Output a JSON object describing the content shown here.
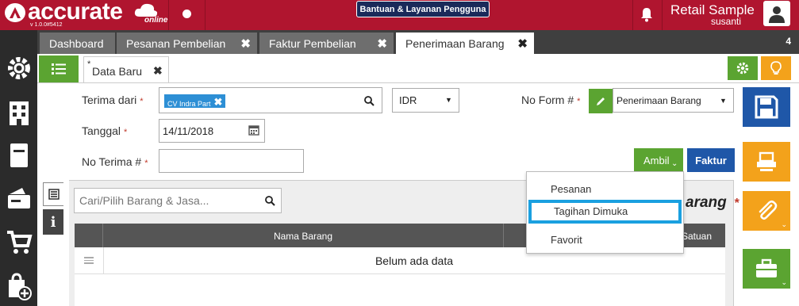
{
  "app": {
    "logo_text": "accurate",
    "logo_online": "online",
    "version": "v 1.0.0#5412",
    "help_label": "Bantuan & Layanan Pengguna",
    "company": "Retail Sample",
    "user": "susanti"
  },
  "tabs": [
    {
      "label": "Dashboard"
    },
    {
      "label": "Pesanan Pembelian"
    },
    {
      "label": "Faktur Pembelian"
    },
    {
      "label": "Penerimaan Barang"
    }
  ],
  "tab_count": "4",
  "subtab": {
    "star": "*",
    "label": "Data Baru"
  },
  "form": {
    "terima_dari_label": "Terima dari",
    "vendor_tag": "CV Indra Part",
    "currency": "IDR",
    "no_form_label": "No Form #",
    "form_type": "Penerimaan Barang",
    "tanggal_label": "Tanggal",
    "tanggal_value": "14/11/2018",
    "no_terima_label": "No Terima #",
    "no_terima_value": "",
    "required_mark": "*"
  },
  "buttons": {
    "ambil": "Ambil",
    "faktur": "Faktur"
  },
  "detail": {
    "search_placeholder": "Cari/Pilih Barang & Jasa...",
    "barang_title": "arang",
    "col_nama": "Nama Barang",
    "col_satuan": "Satuan",
    "empty_text": "Belum ada data"
  },
  "menu": {
    "items": [
      {
        "label": "Pesanan"
      },
      {
        "label": "Tagihan Dimuka"
      },
      {
        "label": "Favorit"
      }
    ]
  },
  "colors": {
    "brand_red": "#b0152f",
    "green": "#5ba431",
    "blue": "#1f57a8",
    "orange": "#f3a21b",
    "highlight": "#1aa0e0"
  }
}
